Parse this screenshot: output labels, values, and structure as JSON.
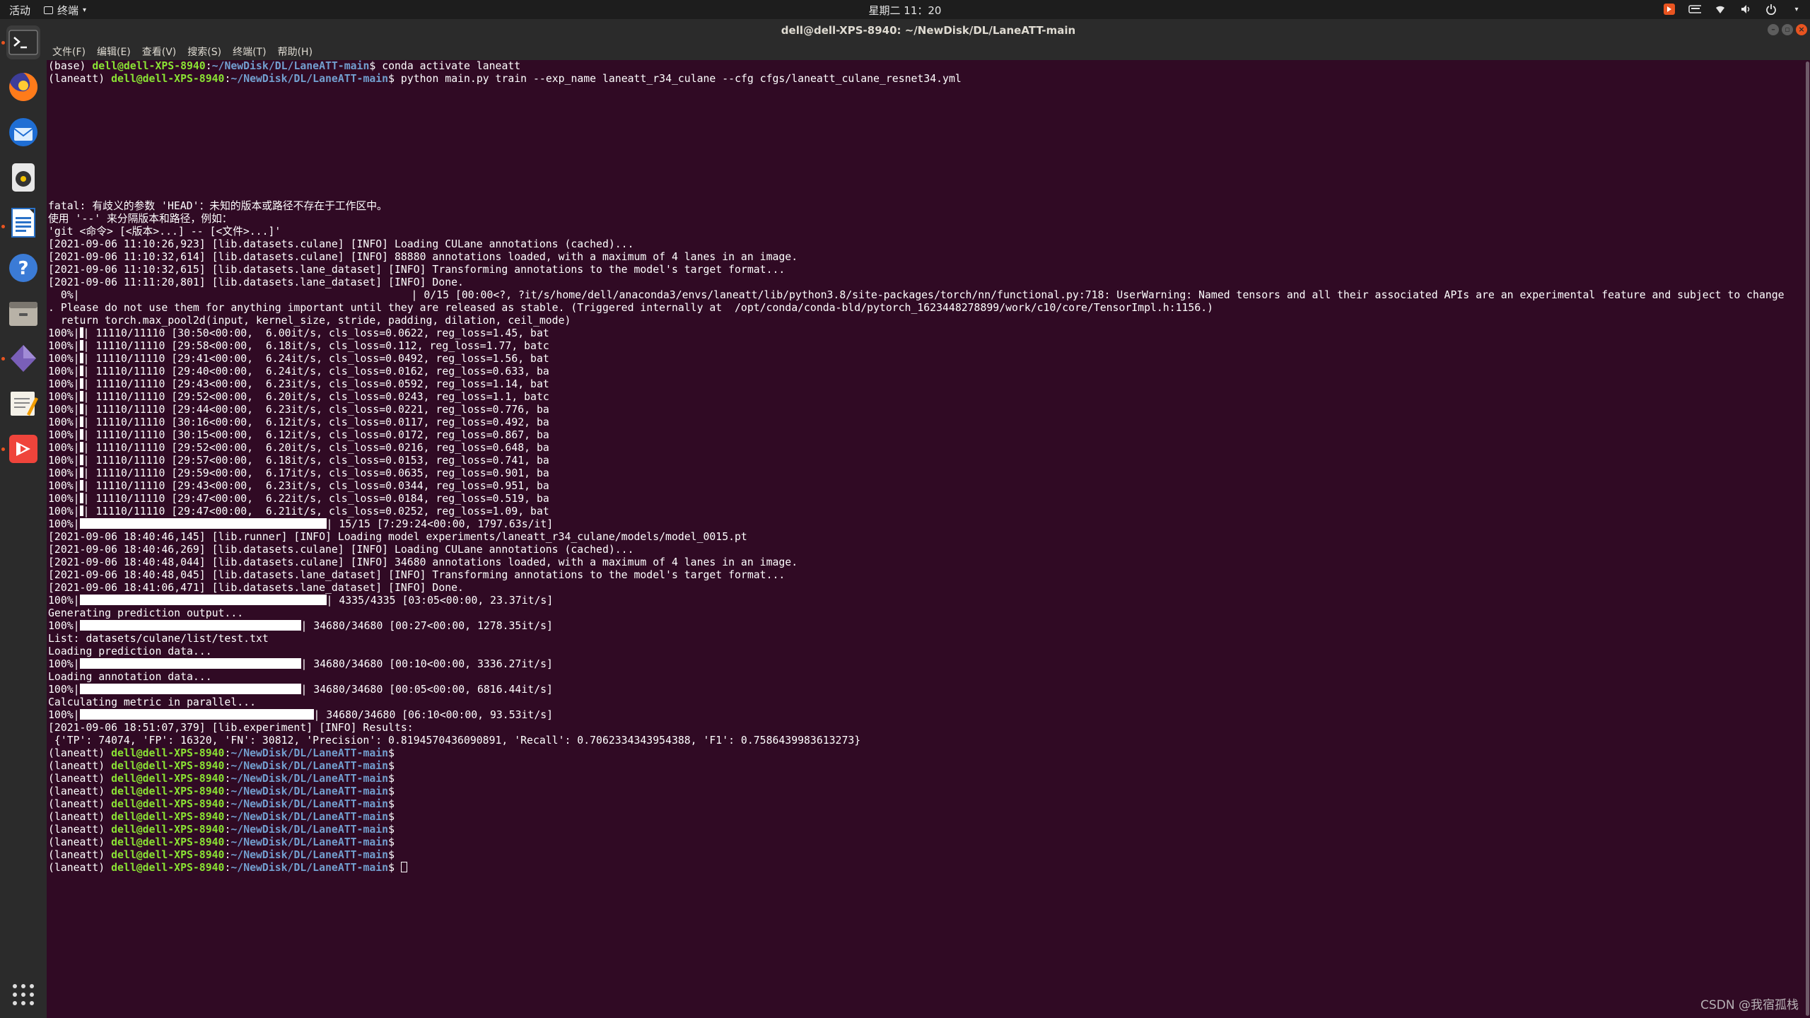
{
  "topbar": {
    "activities": "活动",
    "app_name": "终端",
    "clock": "星期二 11：20"
  },
  "window": {
    "title": "dell@dell-XPS-8940: ~/NewDisk/DL/LaneATT-main",
    "menu": [
      "文件(F)",
      "编辑(E)",
      "查看(V)",
      "搜索(S)",
      "终端(T)",
      "帮助(H)"
    ]
  },
  "prompt": {
    "user": "dell@dell-XPS-8940",
    "path": "~/NewDisk/DL/LaneATT-main"
  },
  "commands": {
    "activate": "conda activate laneatt",
    "train": "python main.py train --exp_name laneatt_r34_culane --cfg cfgs/laneatt_culane_resnet34.yml"
  },
  "output_block1": [
    "fatal: 有歧义的参数 'HEAD'：未知的版本或路径不存在于工作区中。",
    "使用 '--' 来分隔版本和路径，例如：",
    "'git <命令> [<版本>...] -- [<文件>...]'",
    "[2021-09-06 11:10:26,923] [lib.datasets.culane] [INFO] Loading CULane annotations (cached)...",
    "[2021-09-06 11:10:32,614] [lib.datasets.culane] [INFO] 88880 annotations loaded, with a maximum of 4 lanes in an image.",
    "[2021-09-06 11:10:32,615] [lib.datasets.lane_dataset] [INFO] Transforming annotations to the model's target format...",
    "[2021-09-06 11:11:20,801] [lib.datasets.lane_dataset] [INFO] Done."
  ],
  "warning": {
    "prefix": "  0%|",
    "line1": "| 0/15 [00:00<?, ?it/s/home/dell/anaconda3/envs/laneatt/lib/python3.8/site-packages/torch/nn/functional.py:718: UserWarning: Named tensors and all their associated APIs are an experimental feature and subject to change",
    "line2": ". Please do not use them for anything important until they are released as stable. (Triggered internally at  /opt/conda/conda-bld/pytorch_1623448278899/work/c10/core/TensorImpl.h:1156.)",
    "line3": "  return torch.max_pool2d(input, kernel_size, stride, padding, dilation, ceil_mode)"
  },
  "epochs": [
    "| 11110/11110 [30:50<00:00,  6.00it/s, cls_loss=0.0622, reg_loss=1.45, bat",
    "| 11110/11110 [29:58<00:00,  6.18it/s, cls_loss=0.112, reg_loss=1.77, batc",
    "| 11110/11110 [29:41<00:00,  6.24it/s, cls_loss=0.0492, reg_loss=1.56, bat",
    "| 11110/11110 [29:40<00:00,  6.24it/s, cls_loss=0.0162, reg_loss=0.633, ba",
    "| 11110/11110 [29:43<00:00,  6.23it/s, cls_loss=0.0592, reg_loss=1.14, bat",
    "| 11110/11110 [29:52<00:00,  6.20it/s, cls_loss=0.0243, reg_loss=1.1, batc",
    "| 11110/11110 [29:44<00:00,  6.23it/s, cls_loss=0.0221, reg_loss=0.776, ba",
    "| 11110/11110 [30:16<00:00,  6.12it/s, cls_loss=0.0117, reg_loss=0.492, ba",
    "| 11110/11110 [30:15<00:00,  6.12it/s, cls_loss=0.0172, reg_loss=0.867, ba",
    "| 11110/11110 [29:52<00:00,  6.20it/s, cls_loss=0.0216, reg_loss=0.648, ba",
    "| 11110/11110 [29:57<00:00,  6.18it/s, cls_loss=0.0153, reg_loss=0.741, ba",
    "| 11110/11110 [29:59<00:00,  6.17it/s, cls_loss=0.0635, reg_loss=0.901, ba",
    "| 11110/11110 [29:43<00:00,  6.23it/s, cls_loss=0.0344, reg_loss=0.951, ba",
    "| 11110/11110 [29:47<00:00,  6.22it/s, cls_loss=0.0184, reg_loss=0.519, ba",
    "| 11110/11110 [29:47<00:00,  6.21it/s, cls_loss=0.0252, reg_loss=1.09, bat"
  ],
  "pct_label": "100%|",
  "summary_epochs": "| 15/15 [7:29:24<00:00, 1797.63s/it]",
  "output_block2": [
    "[2021-09-06 18:40:46,145] [lib.runner] [INFO] Loading model experiments/laneatt_r34_culane/models/model_0015.pt",
    "[2021-09-06 18:40:46,269] [lib.datasets.culane] [INFO] Loading CULane annotations (cached)...",
    "[2021-09-06 18:40:48,044] [lib.datasets.culane] [INFO] 34680 annotations loaded, with a maximum of 4 lanes in an image.",
    "[2021-09-06 18:40:48,045] [lib.datasets.lane_dataset] [INFO] Transforming annotations to the model's target format...",
    "[2021-09-06 18:41:06,471] [lib.datasets.lane_dataset] [INFO] Done."
  ],
  "eval": {
    "p1": "| 4335/4335 [03:05<00:00, 23.37it/s]",
    "gen": "Generating prediction output...",
    "p2": "| 34680/34680 [00:27<00:00, 1278.35it/s]",
    "list": "List: datasets/culane/list/test.txt",
    "loadpred": "Loading prediction data...",
    "p3": "| 34680/34680 [00:10<00:00, 3336.27it/s]",
    "loadann": "Loading annotation data...",
    "p4": "| 34680/34680 [00:05<00:00, 6816.44it/s]",
    "calc": "Calculating metric in parallel...",
    "p5": "| 34680/34680 [06:10<00:00, 93.53it/s]",
    "results_hdr": "[2021-09-06 18:51:07,379] [lib.experiment] [INFO] Results:",
    "results": " {'TP': 74074, 'FP': 16320, 'FN': 30812, 'Precision': 0.8194570436090891, 'Recall': 0.7062334343954388, 'F1': 0.7586439983613273}"
  },
  "env_labels": {
    "base": "(base) ",
    "laneatt": "(laneatt) "
  },
  "trailing_prompt_count": 10,
  "watermark": "CSDN @我宿孤栈",
  "colors": {
    "bg": "#300a24",
    "user": "#8ae234",
    "path": "#729fcf",
    "accent": "#e95420"
  },
  "dock_icons": [
    "terminal-icon",
    "firefox-icon",
    "thunderbird-icon",
    "rhythmbox-icon",
    "libreoffice-writer-icon",
    "help-icon",
    "files-icon",
    "app-icon",
    "text-editor-icon",
    "anydesk-icon",
    "show-apps-icon"
  ]
}
